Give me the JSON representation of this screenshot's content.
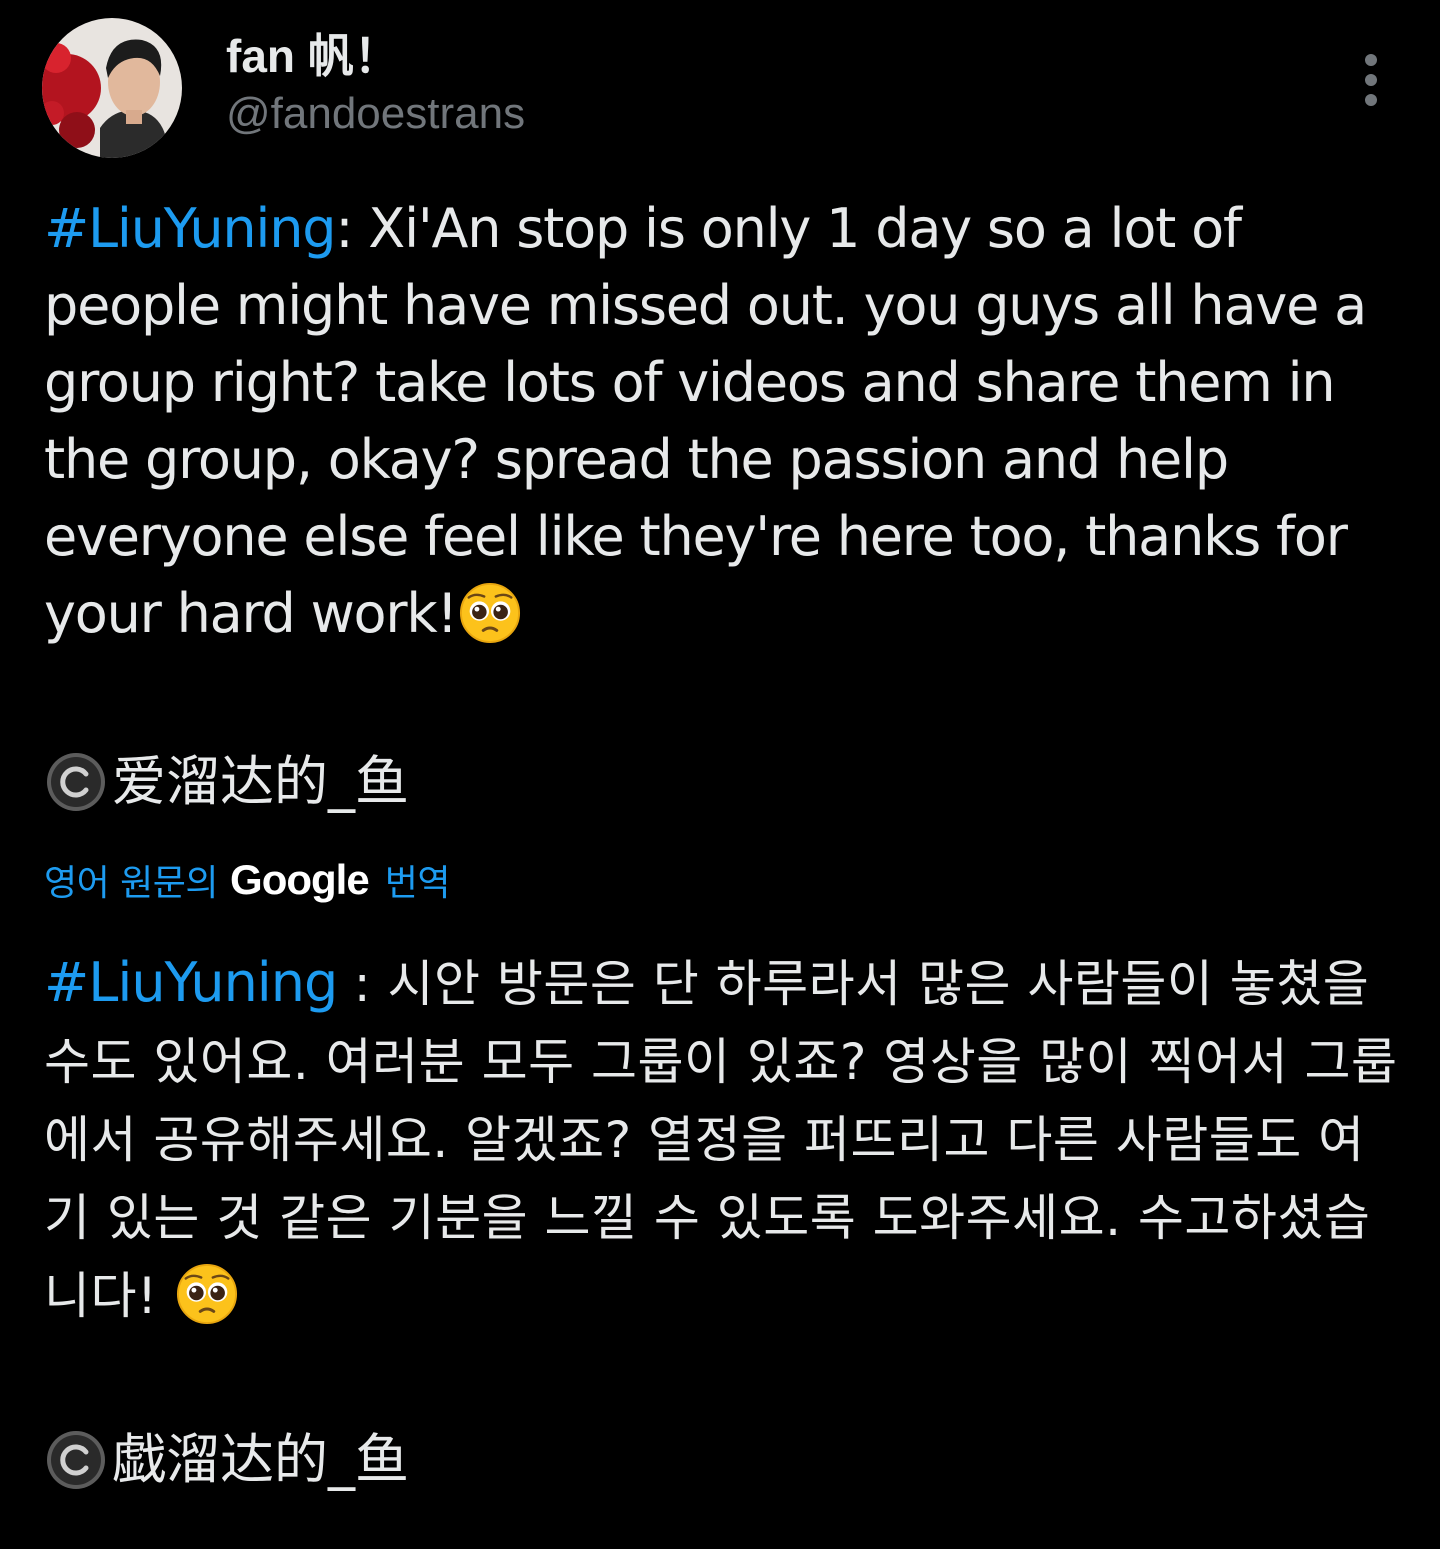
{
  "colors": {
    "background": "#000000",
    "text": "#e7e9ea",
    "secondary_text": "#71767b",
    "accent": "#1d9bf0"
  },
  "author": {
    "display_name": "fan 帆！",
    "handle": "@fandoestrans",
    "avatar_icon": "profile-photo"
  },
  "menu": {
    "more_icon": "vertical-ellipsis-icon"
  },
  "tweet": {
    "hashtag": "#LiuYuning",
    "body": ": Xi'An stop is only 1 day so a lot of people might have missed out. you guys all have a group right? take lots of videos and share them in the group, okay? spread the passion and help everyone else feel like they're here too, thanks for your hard work!",
    "emoji": "pleading-face-emoji",
    "credit_symbol": "copyright-icon",
    "credit_name": "爱溜达的_鱼"
  },
  "translation": {
    "prefix": "영어 원문의",
    "provider": "Google",
    "suffix": "번역",
    "hashtag": "#LiuYuning",
    "body": " : 시안 방문은 단 하루라서 많은 사람들이 놓쳤을 수도 있어요. 여러분 모두 그룹이 있죠? 영상을 많이 찍어서 그룹에서 공유해주세요. 알겠죠? 열정을 퍼뜨리고 다른 사람들도 여기 있는 것 같은 기분을 느낄 수 있도록 도와주세요. 수고하셨습니다! ",
    "emoji": "pleading-face-emoji",
    "credit_symbol": "copyright-icon",
    "credit_name": "戯溜达的_鱼"
  }
}
